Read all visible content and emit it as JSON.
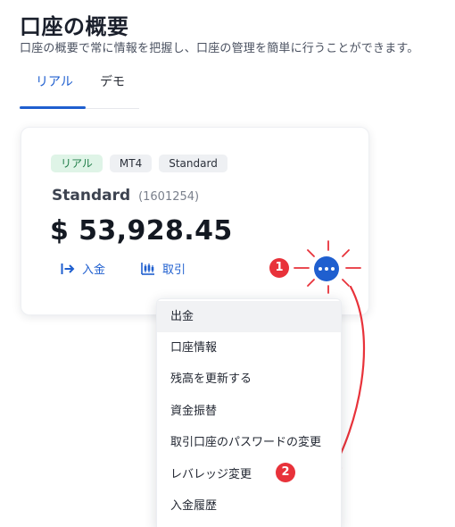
{
  "page": {
    "title": "口座の概要",
    "subtitle": "口座の概要で常に情報を把握し、口座の管理を簡単に行うことができます。"
  },
  "tabs": [
    {
      "label": "リアル",
      "active": true
    },
    {
      "label": "デモ",
      "active": false
    }
  ],
  "account_card": {
    "badges": [
      "リアル",
      "MT4",
      "Standard"
    ],
    "account_type": "Standard",
    "account_id": "(1601254)",
    "balance": "$ 53,928.45",
    "actions": {
      "deposit_label": "入金",
      "trade_label": "取引"
    }
  },
  "menu": {
    "items": [
      "出金",
      "口座情報",
      "残高を更新する",
      "資金振替",
      "取引口座のパスワードの変更",
      "レバレッジ変更",
      "入金履歴"
    ],
    "highlighted_index": 0
  },
  "annotations": {
    "step1": "1",
    "step2": "2"
  },
  "colors": {
    "accent": "#1f5fcf",
    "callout": "#e8323a",
    "badge_real_bg": "#dff4e7",
    "badge_grey_bg": "#eef0f3"
  },
  "icons": {
    "deposit": "arrow-into-bar-icon",
    "trade": "candlestick-chart-icon",
    "more": "more-dots-icon"
  }
}
